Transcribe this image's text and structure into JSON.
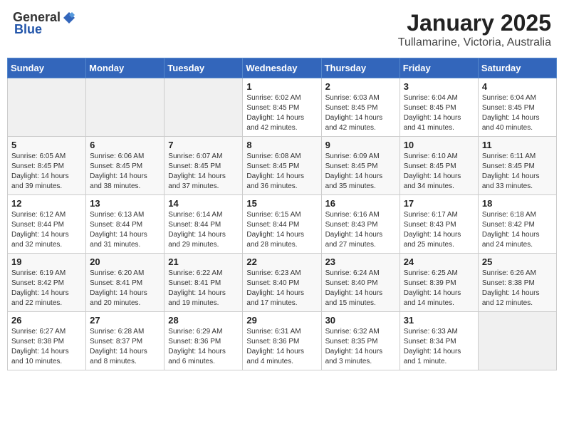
{
  "header": {
    "logo_general": "General",
    "logo_blue": "Blue",
    "title": "January 2025",
    "subtitle": "Tullamarine, Victoria, Australia"
  },
  "days_of_week": [
    "Sunday",
    "Monday",
    "Tuesday",
    "Wednesday",
    "Thursday",
    "Friday",
    "Saturday"
  ],
  "weeks": [
    [
      {
        "day": "",
        "info": ""
      },
      {
        "day": "",
        "info": ""
      },
      {
        "day": "",
        "info": ""
      },
      {
        "day": "1",
        "info": "Sunrise: 6:02 AM\nSunset: 8:45 PM\nDaylight: 14 hours\nand 42 minutes."
      },
      {
        "day": "2",
        "info": "Sunrise: 6:03 AM\nSunset: 8:45 PM\nDaylight: 14 hours\nand 42 minutes."
      },
      {
        "day": "3",
        "info": "Sunrise: 6:04 AM\nSunset: 8:45 PM\nDaylight: 14 hours\nand 41 minutes."
      },
      {
        "day": "4",
        "info": "Sunrise: 6:04 AM\nSunset: 8:45 PM\nDaylight: 14 hours\nand 40 minutes."
      }
    ],
    [
      {
        "day": "5",
        "info": "Sunrise: 6:05 AM\nSunset: 8:45 PM\nDaylight: 14 hours\nand 39 minutes."
      },
      {
        "day": "6",
        "info": "Sunrise: 6:06 AM\nSunset: 8:45 PM\nDaylight: 14 hours\nand 38 minutes."
      },
      {
        "day": "7",
        "info": "Sunrise: 6:07 AM\nSunset: 8:45 PM\nDaylight: 14 hours\nand 37 minutes."
      },
      {
        "day": "8",
        "info": "Sunrise: 6:08 AM\nSunset: 8:45 PM\nDaylight: 14 hours\nand 36 minutes."
      },
      {
        "day": "9",
        "info": "Sunrise: 6:09 AM\nSunset: 8:45 PM\nDaylight: 14 hours\nand 35 minutes."
      },
      {
        "day": "10",
        "info": "Sunrise: 6:10 AM\nSunset: 8:45 PM\nDaylight: 14 hours\nand 34 minutes."
      },
      {
        "day": "11",
        "info": "Sunrise: 6:11 AM\nSunset: 8:45 PM\nDaylight: 14 hours\nand 33 minutes."
      }
    ],
    [
      {
        "day": "12",
        "info": "Sunrise: 6:12 AM\nSunset: 8:44 PM\nDaylight: 14 hours\nand 32 minutes."
      },
      {
        "day": "13",
        "info": "Sunrise: 6:13 AM\nSunset: 8:44 PM\nDaylight: 14 hours\nand 31 minutes."
      },
      {
        "day": "14",
        "info": "Sunrise: 6:14 AM\nSunset: 8:44 PM\nDaylight: 14 hours\nand 29 minutes."
      },
      {
        "day": "15",
        "info": "Sunrise: 6:15 AM\nSunset: 8:44 PM\nDaylight: 14 hours\nand 28 minutes."
      },
      {
        "day": "16",
        "info": "Sunrise: 6:16 AM\nSunset: 8:43 PM\nDaylight: 14 hours\nand 27 minutes."
      },
      {
        "day": "17",
        "info": "Sunrise: 6:17 AM\nSunset: 8:43 PM\nDaylight: 14 hours\nand 25 minutes."
      },
      {
        "day": "18",
        "info": "Sunrise: 6:18 AM\nSunset: 8:42 PM\nDaylight: 14 hours\nand 24 minutes."
      }
    ],
    [
      {
        "day": "19",
        "info": "Sunrise: 6:19 AM\nSunset: 8:42 PM\nDaylight: 14 hours\nand 22 minutes."
      },
      {
        "day": "20",
        "info": "Sunrise: 6:20 AM\nSunset: 8:41 PM\nDaylight: 14 hours\nand 20 minutes."
      },
      {
        "day": "21",
        "info": "Sunrise: 6:22 AM\nSunset: 8:41 PM\nDaylight: 14 hours\nand 19 minutes."
      },
      {
        "day": "22",
        "info": "Sunrise: 6:23 AM\nSunset: 8:40 PM\nDaylight: 14 hours\nand 17 minutes."
      },
      {
        "day": "23",
        "info": "Sunrise: 6:24 AM\nSunset: 8:40 PM\nDaylight: 14 hours\nand 15 minutes."
      },
      {
        "day": "24",
        "info": "Sunrise: 6:25 AM\nSunset: 8:39 PM\nDaylight: 14 hours\nand 14 minutes."
      },
      {
        "day": "25",
        "info": "Sunrise: 6:26 AM\nSunset: 8:38 PM\nDaylight: 14 hours\nand 12 minutes."
      }
    ],
    [
      {
        "day": "26",
        "info": "Sunrise: 6:27 AM\nSunset: 8:38 PM\nDaylight: 14 hours\nand 10 minutes."
      },
      {
        "day": "27",
        "info": "Sunrise: 6:28 AM\nSunset: 8:37 PM\nDaylight: 14 hours\nand 8 minutes."
      },
      {
        "day": "28",
        "info": "Sunrise: 6:29 AM\nSunset: 8:36 PM\nDaylight: 14 hours\nand 6 minutes."
      },
      {
        "day": "29",
        "info": "Sunrise: 6:31 AM\nSunset: 8:36 PM\nDaylight: 14 hours\nand 4 minutes."
      },
      {
        "day": "30",
        "info": "Sunrise: 6:32 AM\nSunset: 8:35 PM\nDaylight: 14 hours\nand 3 minutes."
      },
      {
        "day": "31",
        "info": "Sunrise: 6:33 AM\nSunset: 8:34 PM\nDaylight: 14 hours\nand 1 minute."
      },
      {
        "day": "",
        "info": ""
      }
    ]
  ]
}
